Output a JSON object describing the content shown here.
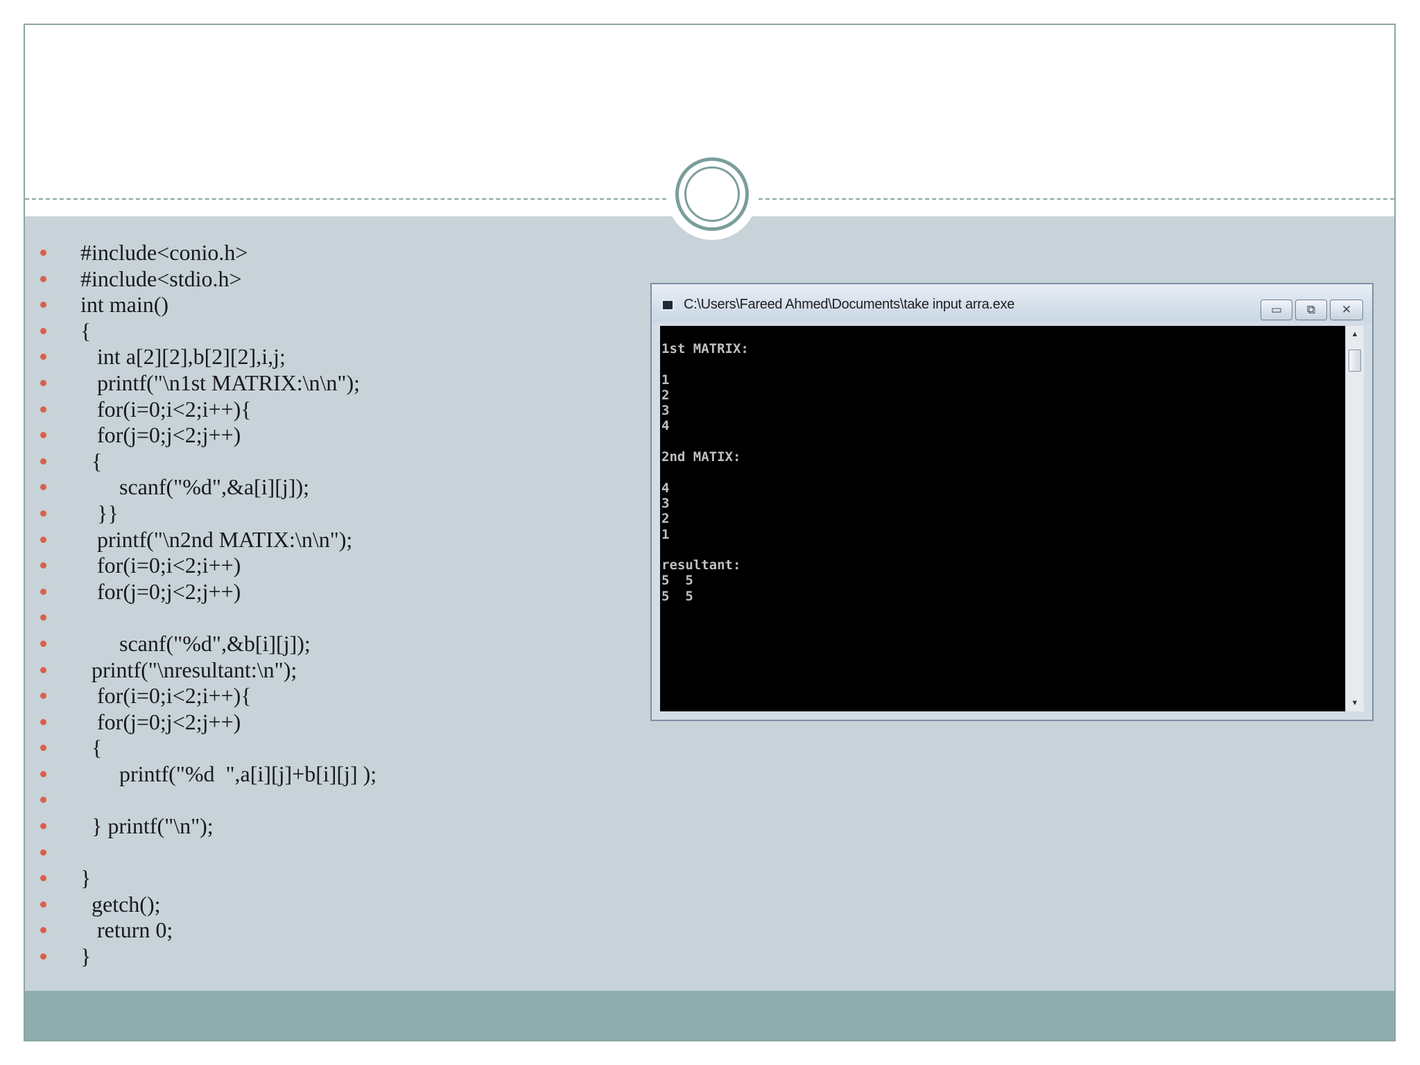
{
  "code": [
    {
      "text": "#include<conio.h>"
    },
    {
      "text": "#include<stdio.h>"
    },
    {
      "text": "int main()"
    },
    {
      "text": "{"
    },
    {
      "text": "   int a[2][2],b[2][2],i,j;"
    },
    {
      "text": "   printf(\"\\n1st MATRIX:\\n\\n\");"
    },
    {
      "text": "   for(i=0;i<2;i++){"
    },
    {
      "text": "   for(j=0;j<2;j++)"
    },
    {
      "text": "  {"
    },
    {
      "text": "       scanf(\"%d\",&a[i][j]);"
    },
    {
      "text": "   }}"
    },
    {
      "text": "   printf(\"\\n2nd MATIX:\\n\\n\");"
    },
    {
      "text": "   for(i=0;i<2;i++)"
    },
    {
      "text": "   for(j=0;j<2;j++)"
    },
    {
      "text": ""
    },
    {
      "text": "       scanf(\"%d\",&b[i][j]);"
    },
    {
      "text": "  printf(\"\\nresultant:\\n\");"
    },
    {
      "text": "   for(i=0;i<2;i++){"
    },
    {
      "text": "   for(j=0;j<2;j++)"
    },
    {
      "text": "  {"
    },
    {
      "text": "       printf(\"%d  \",a[i][j]+b[i][j] );"
    },
    {
      "text": ""
    },
    {
      "text": "  } printf(\"\\n\");"
    },
    {
      "text": ""
    },
    {
      "text": "}"
    },
    {
      "text": "  getch();"
    },
    {
      "text": "   return 0;"
    },
    {
      "text": "}"
    }
  ],
  "console": {
    "title": "C:\\Users\\Fareed Ahmed\\Documents\\take input arra.exe",
    "output": "1st MATRIX:\n\n1\n2\n3\n4\n\n2nd MATIX:\n\n4\n3\n2\n1\n\nresultant:\n5  5\n5  5",
    "buttons": {
      "minimize": "▭",
      "maximize": "⧉",
      "close": "✕"
    },
    "scroll_up": "▲",
    "scroll_down": "▼"
  },
  "colors": {
    "content_band": "#c7d3d9",
    "footer_band": "#8eaeae",
    "accent_ring": "#7a9e9a",
    "bullet": "#d9604a"
  }
}
